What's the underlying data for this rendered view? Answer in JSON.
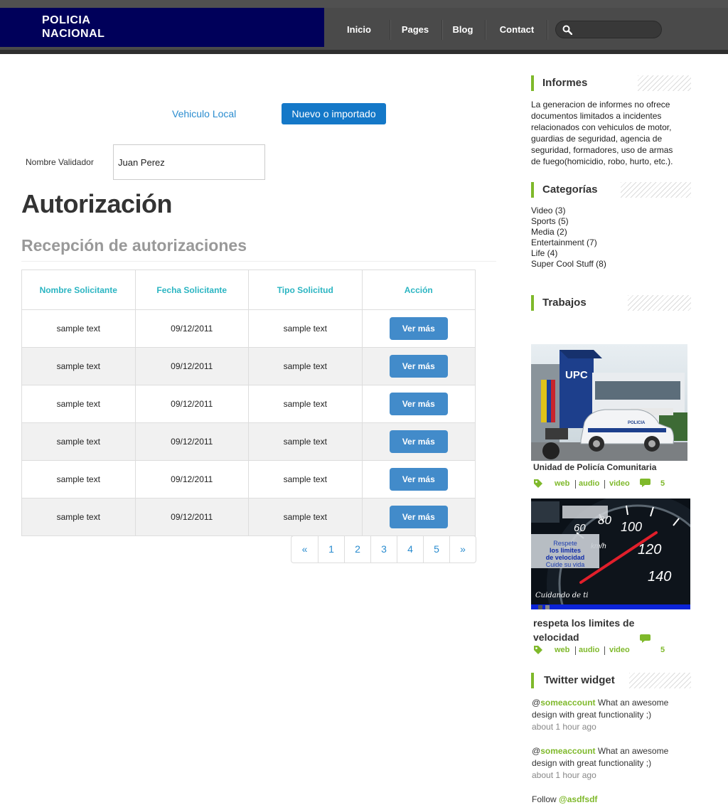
{
  "header": {
    "logo_line1": "POLICIA",
    "logo_line2": "NACIONAL",
    "nav": [
      "Inicio",
      "Pages",
      "Blog",
      "Contact"
    ],
    "search_placeholder": ""
  },
  "main": {
    "link_local": "Vehiculo Local",
    "btn_nuevo": "Nuevo o importado",
    "validador_label": "Nombre Validador",
    "validador_value": "Juan Perez",
    "title": "Autorización",
    "subtitle": "Recepción de autorizaciones",
    "table": {
      "headers": [
        "Nombre Solicitante",
        "Fecha Solicitante",
        "Tipo Solicitud",
        "Acción"
      ],
      "rows": [
        {
          "nombre": "sample text",
          "fecha": "09/12/2011",
          "tipo": "sample text",
          "accion": "Ver más"
        },
        {
          "nombre": "sample text",
          "fecha": "09/12/2011",
          "tipo": "sample text",
          "accion": "Ver más"
        },
        {
          "nombre": "sample text",
          "fecha": "09/12/2011",
          "tipo": "sample text",
          "accion": "Ver más"
        },
        {
          "nombre": "sample text",
          "fecha": "09/12/2011",
          "tipo": "sample text",
          "accion": "Ver más"
        },
        {
          "nombre": "sample text",
          "fecha": "09/12/2011",
          "tipo": "sample text",
          "accion": "Ver más"
        },
        {
          "nombre": "sample text",
          "fecha": "09/12/2011",
          "tipo": "sample text",
          "accion": "Ver más"
        }
      ]
    },
    "pagination": [
      "«",
      "1",
      "2",
      "3",
      "4",
      "5",
      "»"
    ]
  },
  "sidebar": {
    "informes": {
      "title": "Informes",
      "text": "La generacion de informes no ofrece documentos limitados a incidentes relacionados con vehiculos de motor, guardias de seguridad, agencia de seguridad, formadores, uso de armas de fuego(homicidio, robo, hurto, etc.)."
    },
    "categorias": {
      "title": "Categorías",
      "items": [
        "Video (3)",
        "Sports (5)",
        "Media (2)",
        "Entertainment (7)",
        "Life (4)",
        "Super Cool Stuff (8)"
      ]
    },
    "trabajos": {
      "title": "Trabajos",
      "items": [
        {
          "title": "Unidad de Policía Comunitaria",
          "tags": [
            "web",
            "audio",
            "video"
          ],
          "comments": "5",
          "image_text": [
            "UPC",
            "POLICIA"
          ]
        },
        {
          "title": "respeta los limites de velocidad",
          "tags": [
            "web",
            "audio",
            "video"
          ],
          "comments": "5",
          "image_text": {
            "line1": "Respete",
            "line2": "los limites",
            "line3": "de velocidad",
            "line4": "Cuide su vida",
            "footer": "Cuidando de ti",
            "dial": [
              "60",
              "80",
              "100",
              "120",
              "140",
              "km/h"
            ]
          }
        }
      ]
    },
    "twitter": {
      "title": "Twitter widget",
      "tweets": [
        {
          "prefix": "@",
          "account": "someaccount",
          "text": " What an awesome design with great functionality ;)",
          "ago": "about 1 hour ago"
        },
        {
          "prefix": "@",
          "account": "someaccount",
          "text": " What an awesome design with great functionality ;)",
          "ago": "about 1 hour ago"
        }
      ],
      "follow_prefix": "Follow ",
      "follow_account": "@asdfsdf"
    }
  },
  "colors": {
    "header_bg": "#4a4a4a",
    "logo_bg": "#00005a",
    "accent_green": "#7fb92b",
    "link_blue": "#2a8ccf",
    "button_blue": "#428bca",
    "table_header_teal": "#2bb5c2"
  }
}
